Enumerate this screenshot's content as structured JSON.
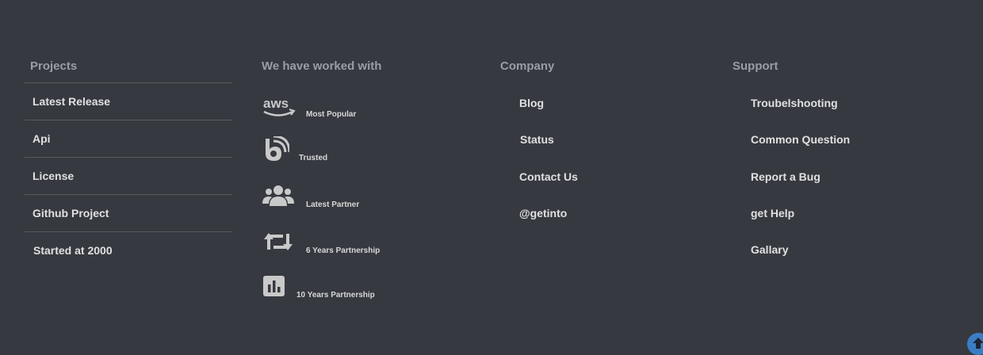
{
  "projects": {
    "title": "Projects",
    "items": [
      "Latest Release",
      "Api",
      "License",
      "Github Project",
      "Started at 2000"
    ]
  },
  "worked": {
    "title": "We have worked with",
    "items": [
      {
        "label": "Most Popular",
        "icon": "aws-icon"
      },
      {
        "label": "Trusted",
        "icon": "bitbucket-icon"
      },
      {
        "label": "Latest Partner",
        "icon": "users-icon"
      },
      {
        "label": "6 Years Partnership",
        "icon": "retweet-icon"
      },
      {
        "label": "10 Years Partnership",
        "icon": "bar-chart-icon"
      }
    ]
  },
  "company": {
    "title": "Company",
    "items": [
      "Blog",
      "Status",
      "Contact Us",
      "@getinto"
    ]
  },
  "support": {
    "title": "Support",
    "items": [
      "Troubelshooting",
      "Common Question",
      "Report a Bug",
      "get Help",
      "Gallary"
    ]
  },
  "colors": {
    "background": "#363940",
    "heading": "#9a9ea4",
    "link": "#e0e0e0",
    "divider": "#565d57",
    "scroll_top": "#3b7dc4"
  }
}
